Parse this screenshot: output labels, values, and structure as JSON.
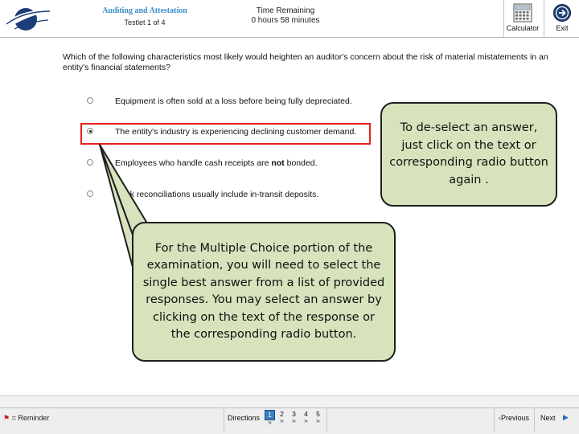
{
  "header": {
    "section_title": "Auditing and Attestation",
    "testlet": "Testlet 1 of 4",
    "time_label": "Time Remaining",
    "time_value": "0 hours 58 minutes",
    "calculator_label": "Calculator",
    "exit_label": "Exit"
  },
  "question": {
    "text": "Which of the following characteristics most likely would heighten an auditor's concern about the risk of material mistatements in an entity's financial statements?",
    "options": [
      {
        "text": "Equipment is often sold at a loss before being fully depreciated.",
        "selected": false
      },
      {
        "text": "The entity's industry is experiencing declining customer demand.",
        "selected": true
      },
      {
        "text_before": "Employees who handle cash receipts are ",
        "text_bold": "not",
        "text_after": " bonded.",
        "selected": false
      },
      {
        "text": "Bank reconciliations usually include in-transit deposits.",
        "selected": false
      }
    ]
  },
  "callouts": {
    "deselect": "To de-select an answer, just click on the text or corresponding radio button again .",
    "instructions": "For the Multiple Choice portion of the examination, you will need to select the single best answer from a list of provided responses. You may select an answer by clicking on the text of the response or the corresponding radio button."
  },
  "footer": {
    "reminder_label": "= Reminder",
    "directions_label": "Directions",
    "questions": [
      "1",
      "2",
      "3",
      "4",
      "5"
    ],
    "active_question": "1",
    "previous_label": "Previous",
    "next_label": "Next"
  },
  "colors": {
    "callout_fill": "#d6e3bc",
    "highlight_border": "#e61e1e",
    "section_title": "#3a8fc9"
  }
}
